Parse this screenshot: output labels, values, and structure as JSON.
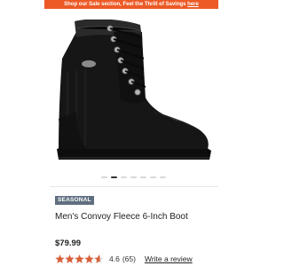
{
  "promo": {
    "text": "Shop our Sale section, Feel the Thrill of Savings ",
    "link": "here",
    "color": "#ec5a26"
  },
  "product": {
    "image_icon": "boot-product-image",
    "carousel": {
      "total": 7,
      "active": 2
    },
    "badge": "SEASONAL",
    "badge_color": "#5f6f80",
    "title": "Men's Convoy Fleece 6-Inch Boot",
    "price": "$79.99"
  },
  "rating": {
    "stars_fraction": 0.92,
    "value": "4.6",
    "count": "(65)",
    "write_review": "Write a review",
    "star_color": "#d9613a"
  }
}
